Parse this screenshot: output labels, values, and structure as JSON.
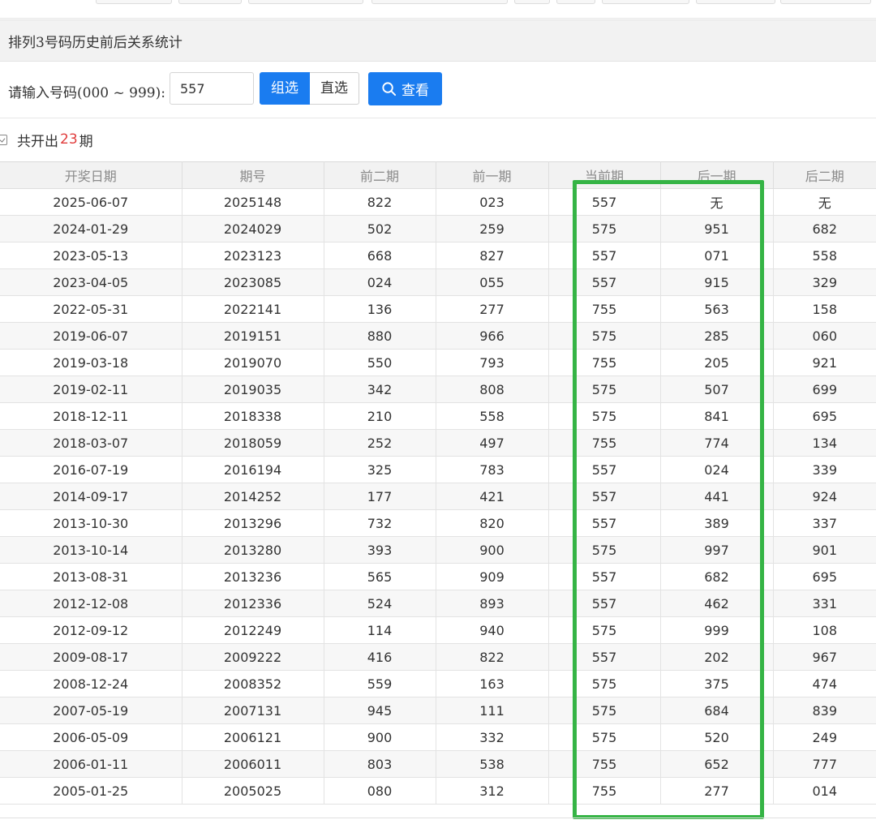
{
  "panel": {
    "title": "排列3号码历史前后关系统计"
  },
  "query": {
    "label": "请输入号码(000 ~ 999):",
    "input_value": "557",
    "mode_group": "组选",
    "mode_direct": "直选",
    "view_button": "查看"
  },
  "summary": {
    "prefix": "共开出",
    "count": "23",
    "suffix": "期"
  },
  "colors": {
    "accent": "#1a7cf0",
    "highlight": "#35b445",
    "count_red": "#e03c3c"
  },
  "table": {
    "headers": [
      "开奖日期",
      "期号",
      "前二期",
      "前一期",
      "当前期",
      "后一期",
      "后二期"
    ],
    "rows": [
      [
        "2025-06-07",
        "2025148",
        "822",
        "023",
        "557",
        "无",
        "无"
      ],
      [
        "2024-01-29",
        "2024029",
        "502",
        "259",
        "575",
        "951",
        "682"
      ],
      [
        "2023-05-13",
        "2023123",
        "668",
        "827",
        "557",
        "071",
        "558"
      ],
      [
        "2023-04-05",
        "2023085",
        "024",
        "055",
        "557",
        "915",
        "329"
      ],
      [
        "2022-05-31",
        "2022141",
        "136",
        "277",
        "755",
        "563",
        "158"
      ],
      [
        "2019-06-07",
        "2019151",
        "880",
        "966",
        "575",
        "285",
        "060"
      ],
      [
        "2019-03-18",
        "2019070",
        "550",
        "793",
        "755",
        "205",
        "921"
      ],
      [
        "2019-02-11",
        "2019035",
        "342",
        "808",
        "575",
        "507",
        "699"
      ],
      [
        "2018-12-11",
        "2018338",
        "210",
        "558",
        "575",
        "841",
        "695"
      ],
      [
        "2018-03-07",
        "2018059",
        "252",
        "497",
        "755",
        "774",
        "134"
      ],
      [
        "2016-07-19",
        "2016194",
        "325",
        "783",
        "557",
        "024",
        "339"
      ],
      [
        "2014-09-17",
        "2014252",
        "177",
        "421",
        "557",
        "441",
        "924"
      ],
      [
        "2013-10-30",
        "2013296",
        "732",
        "820",
        "557",
        "389",
        "337"
      ],
      [
        "2013-10-14",
        "2013280",
        "393",
        "900",
        "575",
        "997",
        "901"
      ],
      [
        "2013-08-31",
        "2013236",
        "565",
        "909",
        "557",
        "682",
        "695"
      ],
      [
        "2012-12-08",
        "2012336",
        "524",
        "893",
        "557",
        "462",
        "331"
      ],
      [
        "2012-09-12",
        "2012249",
        "114",
        "940",
        "575",
        "999",
        "108"
      ],
      [
        "2009-08-17",
        "2009222",
        "416",
        "822",
        "557",
        "202",
        "967"
      ],
      [
        "2008-12-24",
        "2008352",
        "559",
        "163",
        "575",
        "375",
        "474"
      ],
      [
        "2007-05-19",
        "2007131",
        "945",
        "111",
        "575",
        "684",
        "839"
      ],
      [
        "2006-05-09",
        "2006121",
        "900",
        "332",
        "575",
        "520",
        "249"
      ],
      [
        "2006-01-11",
        "2006011",
        "803",
        "538",
        "755",
        "652",
        "777"
      ],
      [
        "2005-01-25",
        "2005025",
        "080",
        "312",
        "755",
        "277",
        "014"
      ]
    ]
  }
}
